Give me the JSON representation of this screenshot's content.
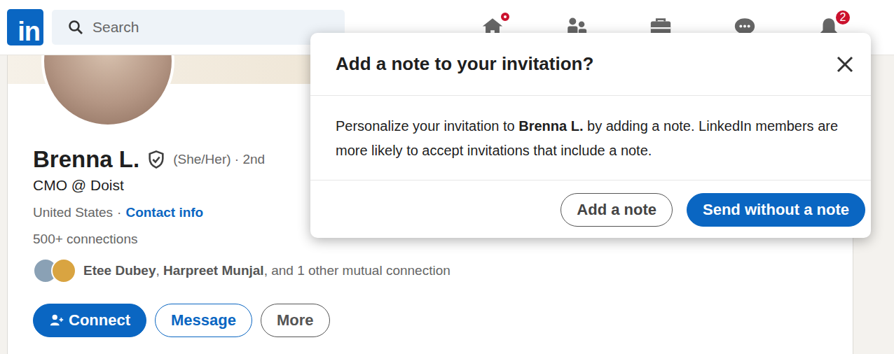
{
  "header": {
    "logo": "in",
    "search": {
      "placeholder": "Search"
    },
    "nav": {
      "home_unread": true,
      "notifications_count": "2"
    }
  },
  "profile": {
    "name": "Brenna L.",
    "verified": true,
    "pronouns_degree": "(She/Her) · 2nd",
    "headline": "CMO @ Doist",
    "location": "United States",
    "separator": "·",
    "contact": "Contact info",
    "connections": "500+ connections",
    "mutual": [
      {
        "text": "Etee Dubey",
        "bold": true
      },
      {
        "text": ", ",
        "bold": false
      },
      {
        "text": "Harpreet Munjal",
        "bold": true
      },
      {
        "text": ", and 1 other mutual connection",
        "bold": false
      }
    ],
    "buttons": [
      {
        "label": "Connect",
        "kind": "primary"
      },
      {
        "label": "Message",
        "kind": "secondary"
      },
      {
        "label": "More",
        "kind": "tertiary"
      }
    ]
  },
  "dialog": {
    "title": "Add a note to your invitation?",
    "body": {
      "before": "Personalize your invitation to ",
      "name": "Brenna L.",
      "after": " by adding a note. LinkedIn members are more likely to accept invitations that include a note."
    },
    "buttons": [
      {
        "label": "Add a note",
        "kind": "secondary"
      },
      {
        "label": "Send without a note",
        "kind": "primary"
      }
    ]
  }
}
